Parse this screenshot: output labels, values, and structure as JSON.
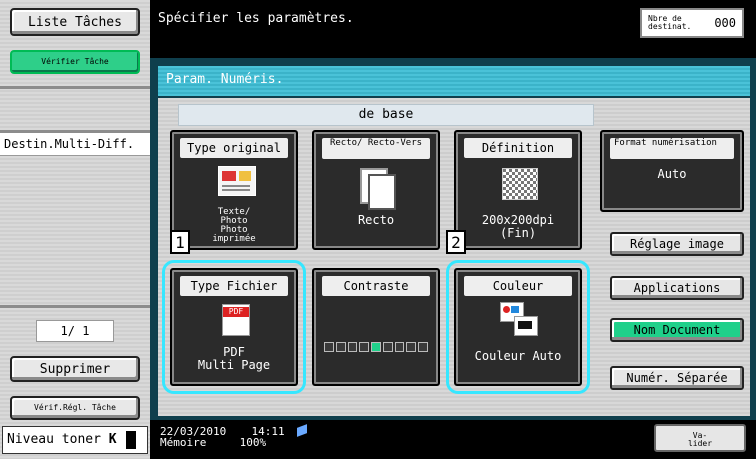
{
  "sidebar": {
    "job_list_label": "Liste Tâches",
    "check_job_label": "Vérifier Tâche",
    "broadcast_label": "Destin.Multi-Diff.",
    "page_counter": "1/  1",
    "delete_label": "Supprimer",
    "check_settings_label": "Vérif.Régl. Tâche",
    "toner_label": "Niveau toner",
    "toner_color": "K"
  },
  "header": {
    "message": "Spécifier les paramètres.",
    "dest_label": "Nbre de destinat.",
    "dest_count": "000"
  },
  "panel": {
    "title": "Param. Numéris.",
    "tab_basic": "de base",
    "tiles": {
      "type_original": {
        "title": "Type original",
        "value_lines": [
          "Texte/",
          "Photo",
          "Photo",
          "imprimée"
        ]
      },
      "recto_verso": {
        "title": "Recto/ Recto-Vers",
        "value": "Recto"
      },
      "definition": {
        "title": "Définition",
        "value_lines": [
          "200x200dpi",
          "(Fin)"
        ]
      },
      "type_fichier": {
        "title": "Type Fichier",
        "value_lines": [
          "PDF",
          "Multi Page"
        ],
        "icon_label": "PDF"
      },
      "contraste": {
        "title": "Contraste"
      },
      "couleur": {
        "title": "Couleur",
        "value": "Couleur Auto"
      }
    },
    "format_numerisation": {
      "title": "Format numérisation",
      "value": "Auto"
    },
    "right_buttons": [
      "Réglage image",
      "Applications",
      "Nom Document",
      "Numér. Séparée"
    ],
    "callouts": [
      "1",
      "2"
    ]
  },
  "footer": {
    "date": "22/03/2010",
    "time": "14:11",
    "memory_label": "Mémoire",
    "memory_value": "100%",
    "validate_label": "Va- lider"
  },
  "colors": {
    "highlight": "#36e7ff",
    "accent_green": "#1fd08a",
    "panel_bg": "#0f3f4d"
  },
  "contrast_level": {
    "selected": 5,
    "total": 9
  }
}
